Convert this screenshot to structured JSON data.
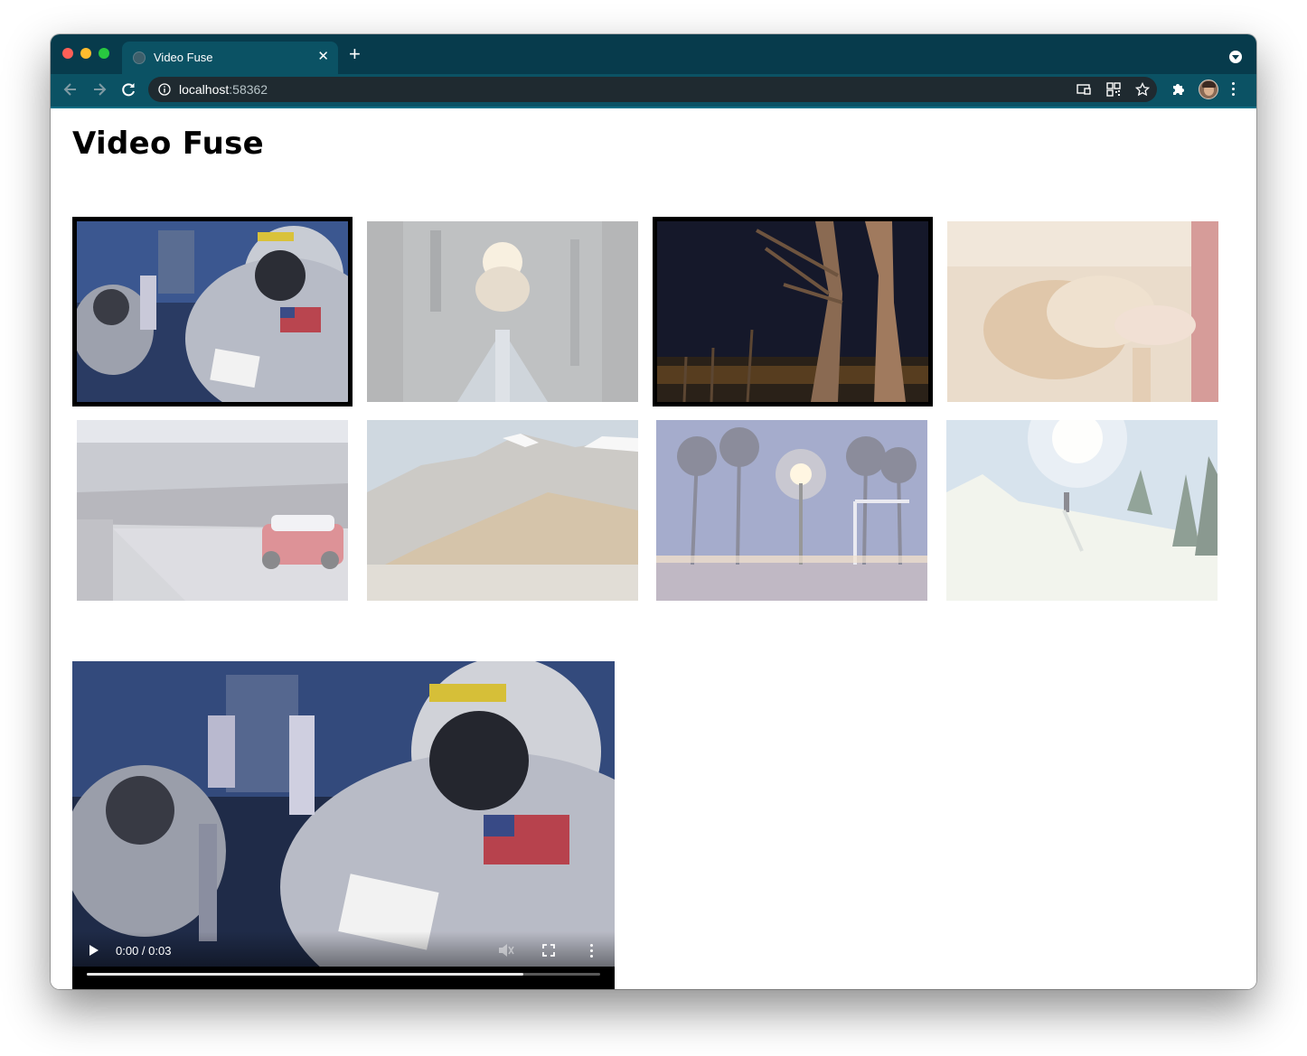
{
  "browser": {
    "tab": {
      "title": "Video Fuse",
      "close_glyph": "✕"
    },
    "new_tab_glyph": "+",
    "address": {
      "host": "localhost",
      "port": ":58362"
    },
    "icons": [
      "back-arrow-icon",
      "forward-arrow-icon",
      "reload-icon",
      "info-icon",
      "cast-icon",
      "qr-code-icon",
      "star-icon",
      "extensions-puzzle-icon",
      "profile-avatar",
      "chrome-menu-icon"
    ]
  },
  "page": {
    "title": "Video Fuse",
    "thumbnails": [
      {
        "scene": "astronaut-spacewalk",
        "selected": true,
        "faded": false
      },
      {
        "scene": "rocket-launch",
        "selected": false,
        "faded": true
      },
      {
        "scene": "night-trees",
        "selected": true,
        "faded": false
      },
      {
        "scene": "bakery-bread",
        "selected": false,
        "faded": true
      },
      {
        "scene": "race-track",
        "selected": false,
        "faded": true
      },
      {
        "scene": "mountains",
        "selected": false,
        "faded": true
      },
      {
        "scene": "palm-street-night",
        "selected": false,
        "faded": true
      },
      {
        "scene": "ski-slope",
        "selected": false,
        "faded": true
      }
    ],
    "player": {
      "scene": "astronaut-spacewalk",
      "time": "0:00 / 0:03",
      "progress": 0.85,
      "controls": [
        "play-icon",
        "volume-muted-icon",
        "fullscreen-icon",
        "more-options-icon"
      ]
    }
  },
  "colors": {
    "tabstrip": "#073b4c",
    "tab_active": "#0b5264",
    "selection_border": "#000000"
  }
}
